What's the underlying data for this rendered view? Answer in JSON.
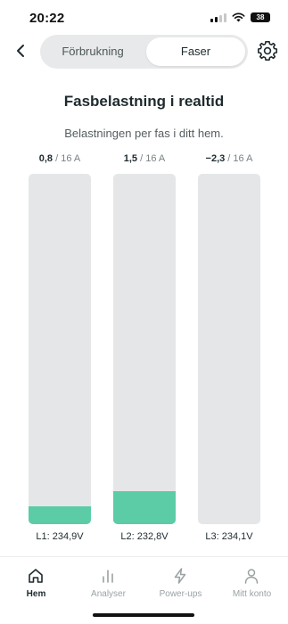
{
  "status_bar": {
    "time": "20:22",
    "battery": "38"
  },
  "header": {
    "tabs": [
      {
        "label": "Förbrukning",
        "active": false
      },
      {
        "label": "Faser",
        "active": true
      }
    ]
  },
  "main": {
    "title": "Fasbelastning i realtid",
    "subtitle": "Belastningen per fas i ditt hem.",
    "phases": [
      {
        "value": "0,8",
        "max": " / 16 A",
        "voltage": "L1: 234,9V",
        "load_fraction": 0.05
      },
      {
        "value": "1,5",
        "max": " / 16 A",
        "voltage": "L2: 232,8V",
        "load_fraction": 0.094
      },
      {
        "value": "−2,3",
        "max": " / 16 A",
        "voltage": "L3: 234,1V",
        "load_fraction": 0.0
      }
    ]
  },
  "tab_bar": {
    "items": [
      {
        "label": "Hem",
        "icon": "home-icon",
        "active": true
      },
      {
        "label": "Analyser",
        "icon": "bar-chart-icon",
        "active": false
      },
      {
        "label": "Power-ups",
        "icon": "lightning-icon",
        "active": false
      },
      {
        "label": "Mitt konto",
        "icon": "person-icon",
        "active": false
      }
    ]
  },
  "colors": {
    "accent": "#5bcca6",
    "bar_track": "#e5e6e7",
    "text": "#1e2a2e"
  }
}
